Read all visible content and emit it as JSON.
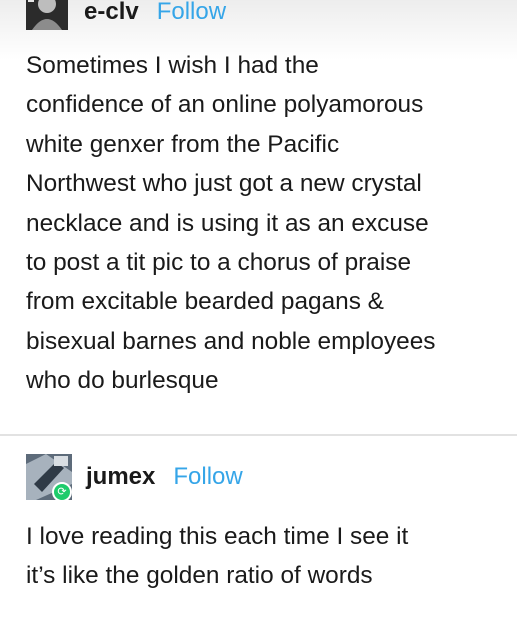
{
  "posts": [
    {
      "username": "e-clv",
      "follow_label": "Follow",
      "avatar_icon": "user-avatar-icon",
      "lines": [
        "Sometimes I wish I had the",
        "confidence of an online polyamorous",
        "white genxer from the Pacific",
        "Northwest who just got a new crystal",
        "necklace and is using it as an excuse",
        "to post a tit pic to a chorus of praise",
        "from excitable bearded pagans &",
        "bisexual barnes and noble employees",
        "who do burlesque"
      ]
    },
    {
      "username": "jumex",
      "follow_label": "Follow",
      "avatar_icon": "user-avatar-icon",
      "badge_icon": "reblog-icon",
      "lines": [
        "I love reading this each time I see it",
        "it’s like the golden ratio of words"
      ]
    }
  ],
  "colors": {
    "follow": "#35a5e8",
    "reblog_badge": "#1ecb6b",
    "text": "#1a1a1a"
  }
}
